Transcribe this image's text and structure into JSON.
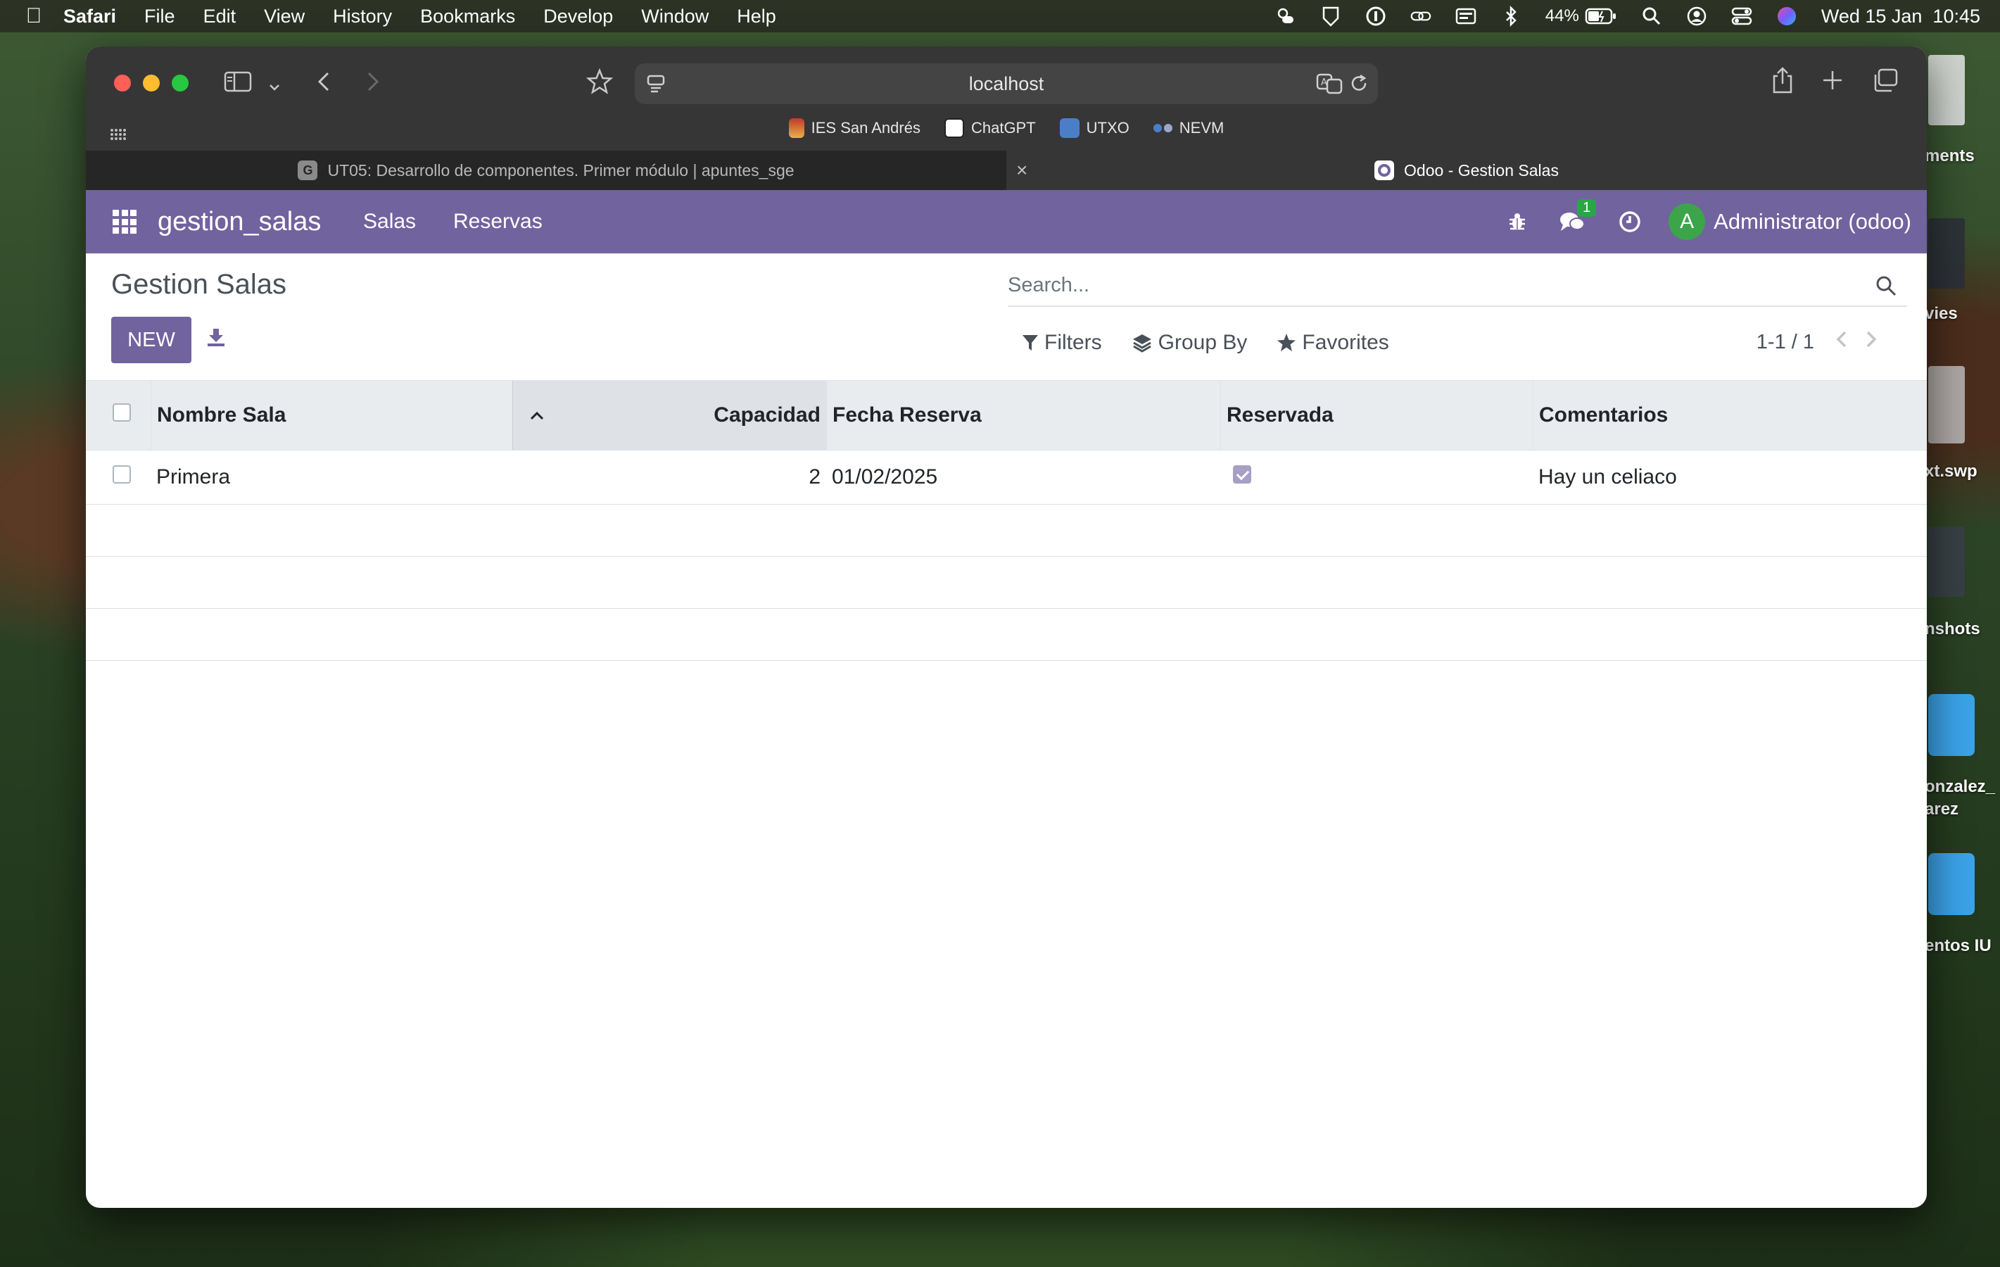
{
  "menubar": {
    "app": "Safari",
    "items": [
      "File",
      "Edit",
      "View",
      "History",
      "Bookmarks",
      "Develop",
      "Window",
      "Help"
    ],
    "battery": "44%",
    "datetime": "Wed 15 Jan  10:45"
  },
  "desktop": {
    "labels": [
      "ments",
      "vies",
      "xt.swp",
      "nshots",
      "onzalez_",
      "arez",
      "entos IU"
    ]
  },
  "browser": {
    "address": "localhost",
    "bookmarks": [
      "IES San Andrés",
      "ChatGPT",
      "UTXO",
      "NEVM"
    ],
    "tabs": [
      {
        "title": "UT05: Desarrollo de componentes. Primer módulo | apuntes_sge",
        "favicon": "G",
        "active": false
      },
      {
        "title": "Odoo - Gestion Salas",
        "active": true
      }
    ]
  },
  "odoo": {
    "brand": "gestion_salas",
    "menus": [
      "Salas",
      "Reservas"
    ],
    "messages_count": "1",
    "avatar_letter": "A",
    "user": "Administrator (odoo)",
    "title": "Gestion Salas",
    "new_label": "NEW",
    "search_placeholder": "Search...",
    "filters_label": "Filters",
    "groupby_label": "Group By",
    "favorites_label": "Favorites",
    "pager": "1-1 / 1",
    "columns": {
      "nombre": "Nombre Sala",
      "capacidad": "Capacidad",
      "fecha": "Fecha Reserva",
      "reservada": "Reservada",
      "comentarios": "Comentarios"
    },
    "rows": [
      {
        "nombre": "Primera",
        "capacidad": "2",
        "fecha": "01/02/2025",
        "reservada": true,
        "comentarios": "Hay un celiaco"
      }
    ]
  },
  "colors": {
    "odoo_primary": "#71639e",
    "badge_green": "#28a745",
    "avatar_green": "#3ca54a"
  }
}
